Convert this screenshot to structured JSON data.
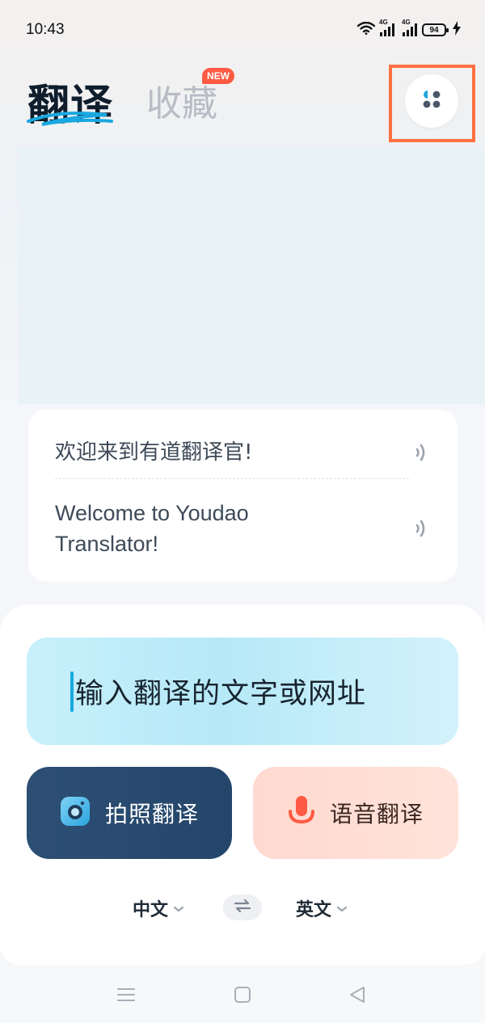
{
  "status_bar": {
    "time": "10:43",
    "network1": "4G",
    "network2": "4G",
    "battery": "94",
    "icons": [
      "wifi-icon",
      "signal-icon",
      "signal-icon",
      "battery-icon",
      "charging-icon"
    ]
  },
  "header": {
    "tab_translate": "翻译",
    "tab_favorites": "收藏",
    "new_badge": "NEW",
    "menu_icon": "apps-grid-icon"
  },
  "example": {
    "zh": "欢迎来到有道翻译官!",
    "en": "Welcome to Youdao Translator!",
    "speaker_icon": "speaker-icon"
  },
  "input": {
    "placeholder": "输入翻译的文字或网址"
  },
  "actions": {
    "photo_label": "拍照翻译",
    "photo_icon": "camera-icon",
    "voice_label": "语音翻译",
    "voice_icon": "microphone-icon"
  },
  "languages": {
    "source": "中文",
    "target": "英文",
    "swap_icon": "swap-icon"
  },
  "nav_bar": {
    "icons": [
      "menu-icon",
      "home-square-icon",
      "back-triangle-icon"
    ]
  },
  "colors": {
    "highlight": "#ff7043",
    "accent_blue": "#19a8e0",
    "photo_button": "#2c4f73",
    "voice_button": "#ffd9cf",
    "mic_red": "#ff5a43",
    "badge": "#ff5a43"
  }
}
